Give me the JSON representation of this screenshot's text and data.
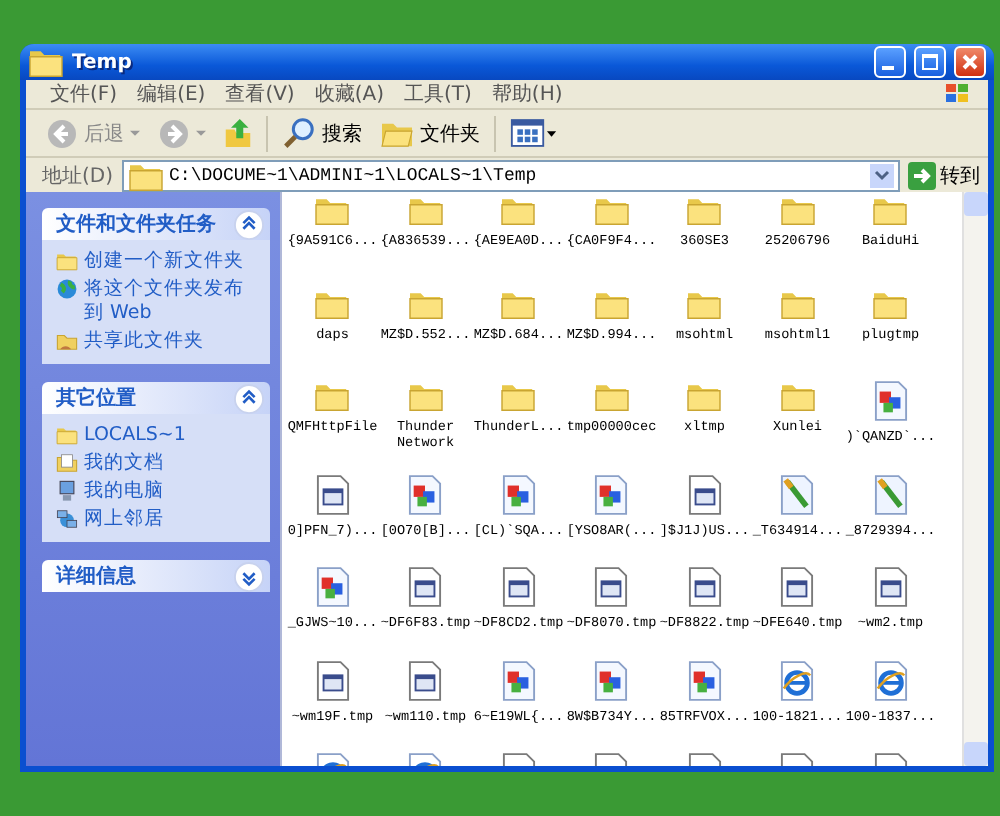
{
  "window": {
    "title": "Temp"
  },
  "menu": [
    "文件(F)",
    "编辑(E)",
    "查看(V)",
    "收藏(A)",
    "工具(T)",
    "帮助(H)"
  ],
  "toolbar": {
    "back": "后退",
    "search": "搜索",
    "folders": "文件夹"
  },
  "address": {
    "label": "地址(D)",
    "value": "C:\\DOCUME~1\\ADMINI~1\\LOCALS~1\\Temp",
    "go": "转到"
  },
  "task_panels": [
    {
      "title": "文件和文件夹任务",
      "expanded": true,
      "items": [
        {
          "label": "创建一个新文件夹",
          "kind": "new-folder"
        },
        {
          "label": "将这个文件夹发布到 Web",
          "kind": "publish"
        },
        {
          "label": "共享此文件夹",
          "kind": "share"
        }
      ]
    },
    {
      "title": "其它位置",
      "expanded": true,
      "items": [
        {
          "label": "LOCALS~1",
          "kind": "folder"
        },
        {
          "label": "我的文档",
          "kind": "documents"
        },
        {
          "label": "我的电脑",
          "kind": "computer"
        },
        {
          "label": "网上邻居",
          "kind": "network"
        }
      ]
    },
    {
      "title": "详细信息",
      "expanded": false
    }
  ],
  "files": [
    {
      "name": "{9A591C6...",
      "kind": "folder"
    },
    {
      "name": "{A836539...",
      "kind": "folder"
    },
    {
      "name": "{AE9EA0D...",
      "kind": "folder"
    },
    {
      "name": "{CA0F9F4...",
      "kind": "folder"
    },
    {
      "name": "360SE3",
      "kind": "folder"
    },
    {
      "name": "25206796",
      "kind": "folder"
    },
    {
      "name": "BaiduHi",
      "kind": "folder"
    },
    {
      "name": "daps",
      "kind": "folder"
    },
    {
      "name": "MZ$D.552...",
      "kind": "folder"
    },
    {
      "name": "MZ$D.684...",
      "kind": "folder"
    },
    {
      "name": "MZ$D.994...",
      "kind": "folder"
    },
    {
      "name": "msohtml",
      "kind": "folder"
    },
    {
      "name": "msohtml1",
      "kind": "folder"
    },
    {
      "name": "plugtmp",
      "kind": "folder"
    },
    {
      "name": "QMFHttpFile",
      "kind": "folder"
    },
    {
      "name": "Thunder Network",
      "kind": "folder"
    },
    {
      "name": "ThunderL...",
      "kind": "folder"
    },
    {
      "name": "tmp00000cec",
      "kind": "folder"
    },
    {
      "name": "xltmp",
      "kind": "folder"
    },
    {
      "name": "Xunlei",
      "kind": "folder"
    },
    {
      "name": ")`QANZD`...",
      "kind": "media"
    },
    {
      "name": "0]PFN_7)...",
      "kind": "file"
    },
    {
      "name": "[0O70[B]...",
      "kind": "media"
    },
    {
      "name": "[CL)`SQA...",
      "kind": "media"
    },
    {
      "name": "[YSO8AR(...",
      "kind": "media"
    },
    {
      "name": "]$J1J)US...",
      "kind": "file"
    },
    {
      "name": "_T634914...",
      "kind": "paint"
    },
    {
      "name": "_8729394...",
      "kind": "paint"
    },
    {
      "name": "_GJWS~10...",
      "kind": "media"
    },
    {
      "name": "~DF6F83.tmp",
      "kind": "file"
    },
    {
      "name": "~DF8CD2.tmp",
      "kind": "file"
    },
    {
      "name": "~DF8070.tmp",
      "kind": "file"
    },
    {
      "name": "~DF8822.tmp",
      "kind": "file"
    },
    {
      "name": "~DFE640.tmp",
      "kind": "file"
    },
    {
      "name": "~wm2.tmp",
      "kind": "file"
    },
    {
      "name": "~wm19F.tmp",
      "kind": "file"
    },
    {
      "name": "~wm110.tmp",
      "kind": "file"
    },
    {
      "name": "6~E19WL{...",
      "kind": "media"
    },
    {
      "name": "8W$B734Y...",
      "kind": "media"
    },
    {
      "name": "85TRFVOX...",
      "kind": "media"
    },
    {
      "name": "100-1821...",
      "kind": "ie"
    },
    {
      "name": "100-1837...",
      "kind": "ie"
    },
    {
      "kind": "ie"
    },
    {
      "kind": "ie"
    },
    {
      "kind": "file"
    },
    {
      "kind": "file"
    },
    {
      "kind": "file"
    },
    {
      "kind": "file"
    },
    {
      "kind": "file"
    }
  ]
}
